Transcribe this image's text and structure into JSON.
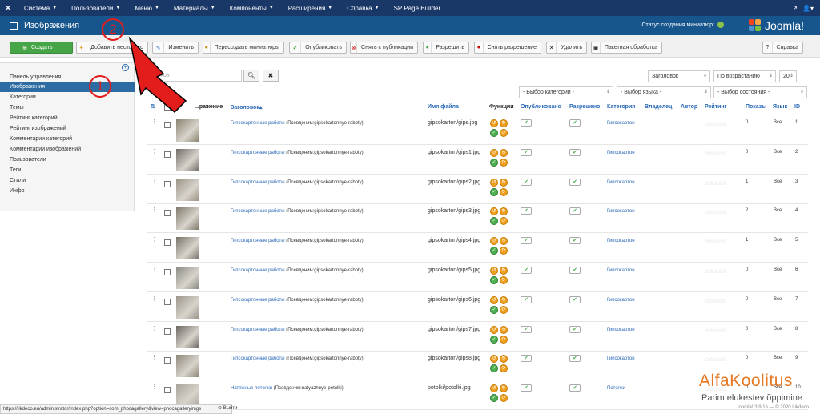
{
  "topnav": {
    "logo_icon": "joomla-icon",
    "menu": [
      {
        "label": "Система"
      },
      {
        "label": "Пользователи"
      },
      {
        "label": "Меню"
      },
      {
        "label": "Материалы"
      },
      {
        "label": "Компоненты"
      },
      {
        "label": "Расширения"
      },
      {
        "label": "Справка"
      },
      {
        "label": "SP Page Builder"
      }
    ]
  },
  "subhead": {
    "title": "Изображения",
    "thumb_status": "Статус создания миниатюр:",
    "brand": "Joomla!"
  },
  "toolbar": {
    "new": "Создать",
    "add_multiple": "Добавить несколько",
    "edit": "Изменить",
    "recreate_thumbs": "Пересоздать миниатюры",
    "publish": "Опубликовать",
    "unpublish": "Снять с публикации",
    "approve": "Разрешить",
    "disapprove": "Снять разрешение",
    "delete": "Удалить",
    "batch": "Пакетная обработка",
    "help": "Справка"
  },
  "sidebar": {
    "items": [
      {
        "label": "Панель управления"
      },
      {
        "label": "Изображения"
      },
      {
        "label": "Категории"
      },
      {
        "label": "Темы"
      },
      {
        "label": "Рейтинг категорий"
      },
      {
        "label": "Рейтинг изображений"
      },
      {
        "label": "Комментарии категорий"
      },
      {
        "label": "Комментарии изображений"
      },
      {
        "label": "Пользователи"
      },
      {
        "label": "Теги"
      },
      {
        "label": "Стили"
      },
      {
        "label": "Инфо"
      }
    ]
  },
  "filters": {
    "search_placeholder": "...ков",
    "ordering": "Заголовок",
    "direction": "По возрастанию",
    "limit": "20",
    "category": "- Выбор категории -",
    "language": "- Выбор языка -",
    "state": "- Выбор состояния -"
  },
  "table": {
    "headers": {
      "image": "...ражение",
      "title": "Заголовок",
      "filename": "Имя файла",
      "functions": "Функции",
      "published": "Опубликовано",
      "approved": "Разрешено",
      "category": "Категория",
      "owner": "Владелец",
      "author": "Автор",
      "rating": "Рейтинг",
      "hits": "Показы",
      "language": "Язык",
      "id": "ID"
    },
    "rows": [
      {
        "title": "Гипсокартонные работы",
        "alias": "(Псевдоним:gipsokartonnye-raboty)",
        "filename": "gipsokarton/gips.jpg",
        "category": "Гипсокартон",
        "hits": "0",
        "lang": "Все",
        "id": "1"
      },
      {
        "title": "Гипсокартонные работы",
        "alias": "(Псевдоним:gipsokartonnye-raboty)",
        "filename": "gipsokarton/gips1.jpg",
        "category": "Гипсокартон",
        "hits": "0",
        "lang": "Все",
        "id": "2"
      },
      {
        "title": "Гипсокартонные работы",
        "alias": "(Псевдоним:gipsokartonnye-raboty)",
        "filename": "gipsokarton/gips2.jpg",
        "category": "Гипсокартон",
        "hits": "1",
        "lang": "Все",
        "id": "3"
      },
      {
        "title": "Гипсокартонные работы",
        "alias": "(Псевдоним:gipsokartonnye-raboty)",
        "filename": "gipsokarton/gips3.jpg",
        "category": "Гипсокартон",
        "hits": "2",
        "lang": "Все",
        "id": "4"
      },
      {
        "title": "Гипсокартонные работы",
        "alias": "(Псевдоним:gipsokartonnye-raboty)",
        "filename": "gipsokarton/gips4.jpg",
        "category": "Гипсокартон",
        "hits": "1",
        "lang": "Все",
        "id": "5"
      },
      {
        "title": "Гипсокартонные работы",
        "alias": "(Псевдоним:gipsokartonnye-raboty)",
        "filename": "gipsokarton/gips5.jpg",
        "category": "Гипсокартон",
        "hits": "0",
        "lang": "Все",
        "id": "6"
      },
      {
        "title": "Гипсокартонные работы",
        "alias": "(Псевдоним:gipsokartonnye-raboty)",
        "filename": "gipsokarton/gips6.jpg",
        "category": "Гипсокартон",
        "hits": "0",
        "lang": "Все",
        "id": "7"
      },
      {
        "title": "Гипсокартонные работы",
        "alias": "(Псевдоним:gipsokartonnye-raboty)",
        "filename": "gipsokarton/gips7.jpg",
        "category": "Гипсокартон",
        "hits": "0",
        "lang": "Все",
        "id": "8"
      },
      {
        "title": "Гипсокартонные работы",
        "alias": "(Псевдоним:gipsokartonnye-raboty)",
        "filename": "gipsokarton/gips8.jpg",
        "category": "Гипсокартон",
        "hits": "0",
        "lang": "Все",
        "id": "9"
      },
      {
        "title": "Натяжные потолки",
        "alias": "(Псевдоним:natyazhnye-potolki)",
        "filename": "potolki/potolki.jpg",
        "category": "Потолки",
        "hits": "0",
        "lang": "Все",
        "id": "10"
      }
    ]
  },
  "statusbar": {
    "url": "https://likdeco.eu/administrator/index.php?option=com_phocagallery&view=phocagalleryimgs",
    "exit": "Выйти",
    "version": "Joomla! 3.9.16 — © 2020 Likdeco"
  },
  "watermark": {
    "brand": "AlfaKoolitus",
    "tagline": "Parim elukestev õppimine"
  },
  "annotations": {
    "badge1": "1",
    "badge2": "2",
    "color": "#e31c1c"
  }
}
